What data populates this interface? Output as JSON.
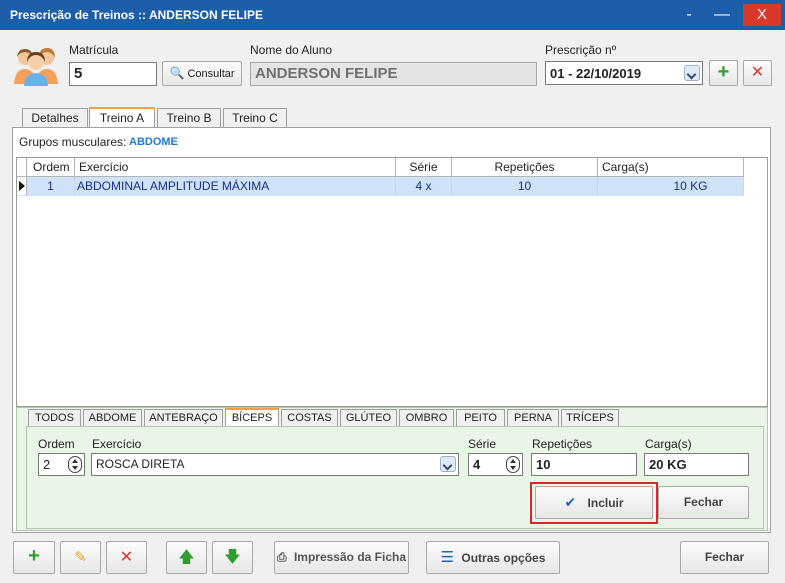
{
  "window": {
    "title": "Prescrição de Treinos  ::  ANDERSON FELIPE",
    "minimize_glyph": "-",
    "maximize_glyph": "—",
    "close_glyph": "X"
  },
  "header": {
    "matricula_label": "Matrícula",
    "matricula_value": "5",
    "consultar_label": "Consultar",
    "nome_label": "Nome do Aluno",
    "nome_value": "ANDERSON FELIPE",
    "prescricao_label": "Prescrição nº",
    "prescricao_value": "01 - 22/10/2019"
  },
  "tabs": [
    {
      "label": "Detalhes"
    },
    {
      "label": "Treino A"
    },
    {
      "label": "Treino B"
    },
    {
      "label": "Treino C"
    }
  ],
  "grupos": {
    "label": "Grupos musculares:",
    "value": "ABDOME"
  },
  "grid": {
    "columns": [
      "Ordem",
      "Exercício",
      "Série",
      "Repetições",
      "Carga(s)"
    ],
    "rows": [
      {
        "ordem": "1",
        "exercicio": "ABDOMINAL AMPLITUDE MÁXIMA",
        "serie": "4 x",
        "repeticoes": "10",
        "carga": "10 KG"
      }
    ]
  },
  "muscle_tabs": [
    "TODOS",
    "ABDOME",
    "ANTEBRAÇO",
    "BÍCEPS",
    "COSTAS",
    "GLÚTEO",
    "OMBRO",
    "PEITO",
    "PERNA",
    "TRÍCEPS"
  ],
  "form": {
    "ordem_label": "Ordem",
    "ordem_value": "2",
    "exercicio_label": "Exercício",
    "exercicio_value": "ROSCA DIRETA",
    "serie_label": "Série",
    "serie_value": "4",
    "repeticoes_label": "Repetições",
    "repeticoes_value": "10",
    "carga_label": "Carga(s)",
    "carga_value": "20 KG",
    "incluir_label": "Incluir",
    "fechar_label": "Fechar"
  },
  "toolbar": {
    "impressao_label": "Impressão da Ficha",
    "outras_label": "Outras opções",
    "fechar_label": "Fechar"
  },
  "colors": {
    "titlebar": "#1c5fa8",
    "close_button": "#d9382b",
    "selected_row": "#cfe2f7",
    "group_value": "#1f7ad0",
    "highlight_border": "#d42a2a",
    "panel": "#e9f5e6"
  }
}
